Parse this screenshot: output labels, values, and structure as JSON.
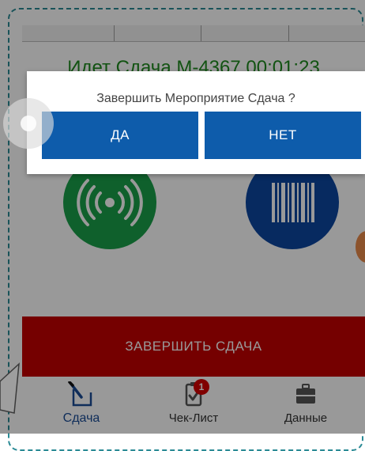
{
  "status": {
    "text": "Идет Сдача М-4367 00:01:23",
    "color": "#1e8a1e"
  },
  "scan_buttons": [
    {
      "icon": "rfid-icon",
      "color": "#1aa04a"
    },
    {
      "icon": "barcode-icon",
      "color": "#0d47a1"
    }
  ],
  "finish_button": {
    "label": "ЗАВЕРШИТЬ СДАЧА",
    "color": "#c40000"
  },
  "bottom_nav": {
    "items": [
      {
        "label": "Сдача",
        "icon": "edit-icon",
        "active": true
      },
      {
        "label": "Чек-Лист",
        "icon": "clipboard-check-icon",
        "badge": "1"
      },
      {
        "label": "Данные",
        "icon": "briefcase-icon"
      }
    ]
  },
  "dialog": {
    "message": "Завершить Мероприятие Сдача ?",
    "yes_label": "ДА",
    "no_label": "НЕТ",
    "button_color": "#0e5cab"
  },
  "colors": {
    "accent": "#1a4c96",
    "frame": "#2a8a95"
  }
}
